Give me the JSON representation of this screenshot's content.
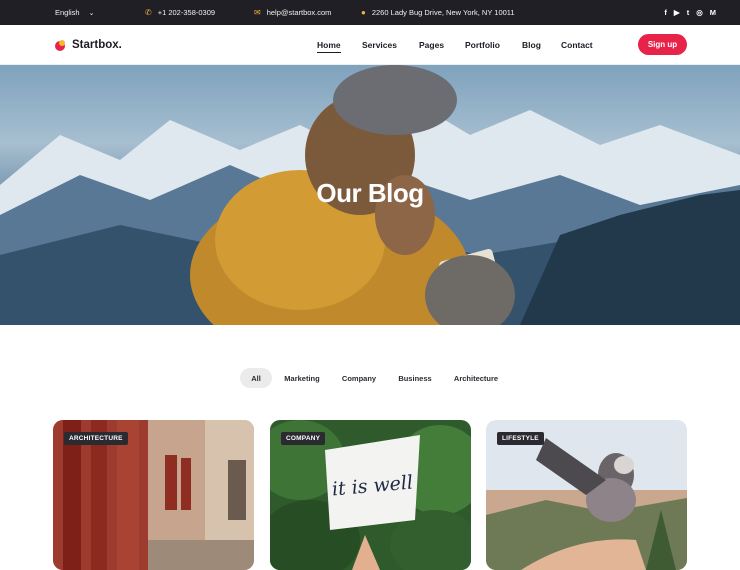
{
  "topbar": {
    "language": "English",
    "phone": "+1 202-358-0309",
    "email": "help@startbox.com",
    "address": "2260 Lady Bug Drive, New York, NY 10011",
    "social": [
      "f",
      "▶",
      "t",
      "◎",
      "M"
    ]
  },
  "brand": {
    "name": "Startbox."
  },
  "nav": {
    "items": [
      {
        "label": "Home",
        "active": true
      },
      {
        "label": "Services"
      },
      {
        "label": "Pages"
      },
      {
        "label": "Portfolio"
      },
      {
        "label": "Blog"
      },
      {
        "label": "Contact"
      }
    ],
    "signup": "Sign up"
  },
  "hero": {
    "title": "Our Blog"
  },
  "filters": [
    "All",
    "Marketing",
    "Company",
    "Business",
    "Architecture"
  ],
  "posts": [
    {
      "category": "ARCHITECTURE"
    },
    {
      "category": "COMPANY",
      "sign_text": "it is well"
    },
    {
      "category": "LIFESTYLE"
    }
  ],
  "colors": {
    "accent": "#e8234a",
    "topbar_bg": "#1f1f25",
    "icon_yellow": "#f2b33d"
  }
}
